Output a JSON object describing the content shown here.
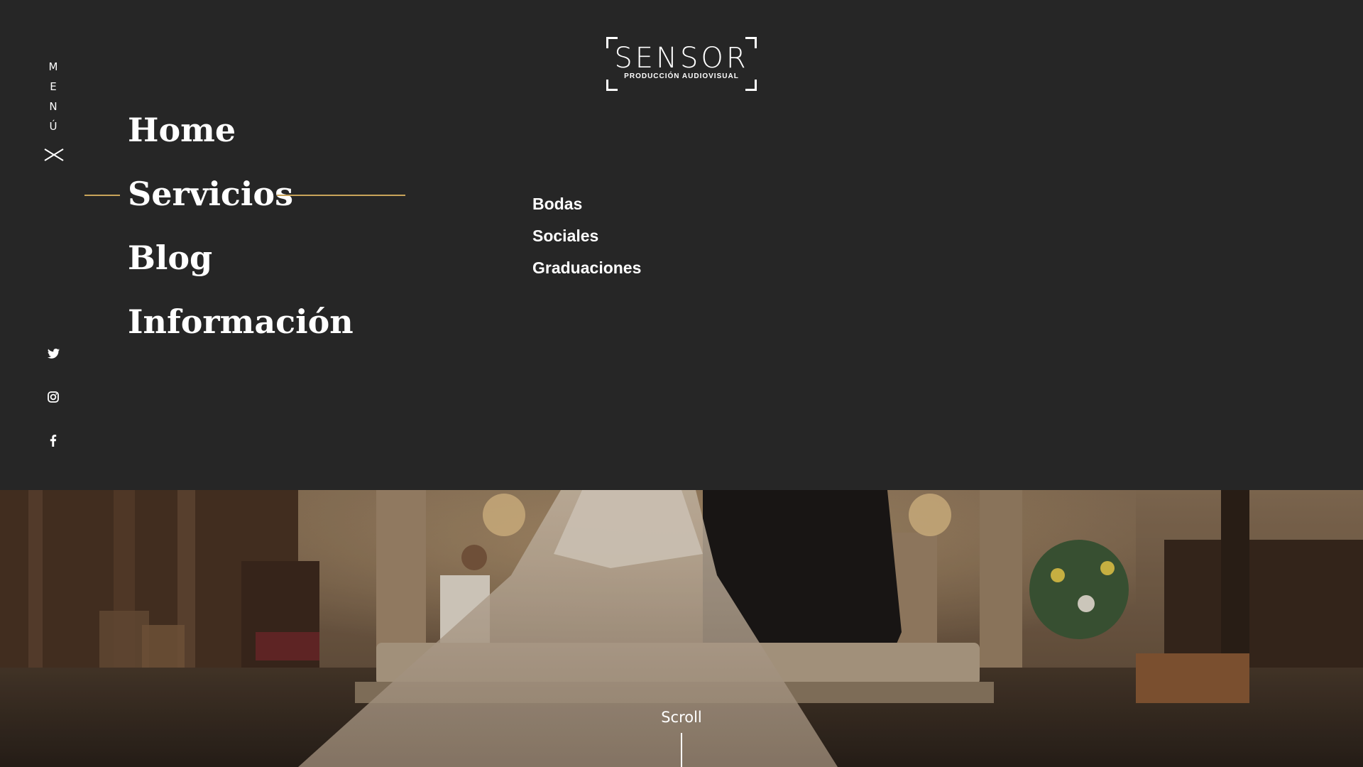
{
  "logo": {
    "main": "SENSOR",
    "sub": "PRODUCCIÓN AUDIOVISUAL"
  },
  "menu_toggle": {
    "letters": [
      "M",
      "E",
      "N",
      "Ú"
    ],
    "close_icon": "close-x-icon"
  },
  "main_nav": {
    "items": [
      {
        "label": "Home"
      },
      {
        "label": "Servicios",
        "active": true
      },
      {
        "label": "Blog"
      },
      {
        "label": "Información"
      }
    ]
  },
  "sub_nav": {
    "items": [
      {
        "label": "Bodas"
      },
      {
        "label": "Sociales"
      },
      {
        "label": "Graduaciones"
      }
    ]
  },
  "social": [
    "twitter-icon",
    "instagram-icon",
    "facebook-icon"
  ],
  "hero": {
    "scroll_label": "Scroll"
  },
  "colors": {
    "background": "#262626",
    "accent": "#c8a45a",
    "text": "#ffffff"
  }
}
